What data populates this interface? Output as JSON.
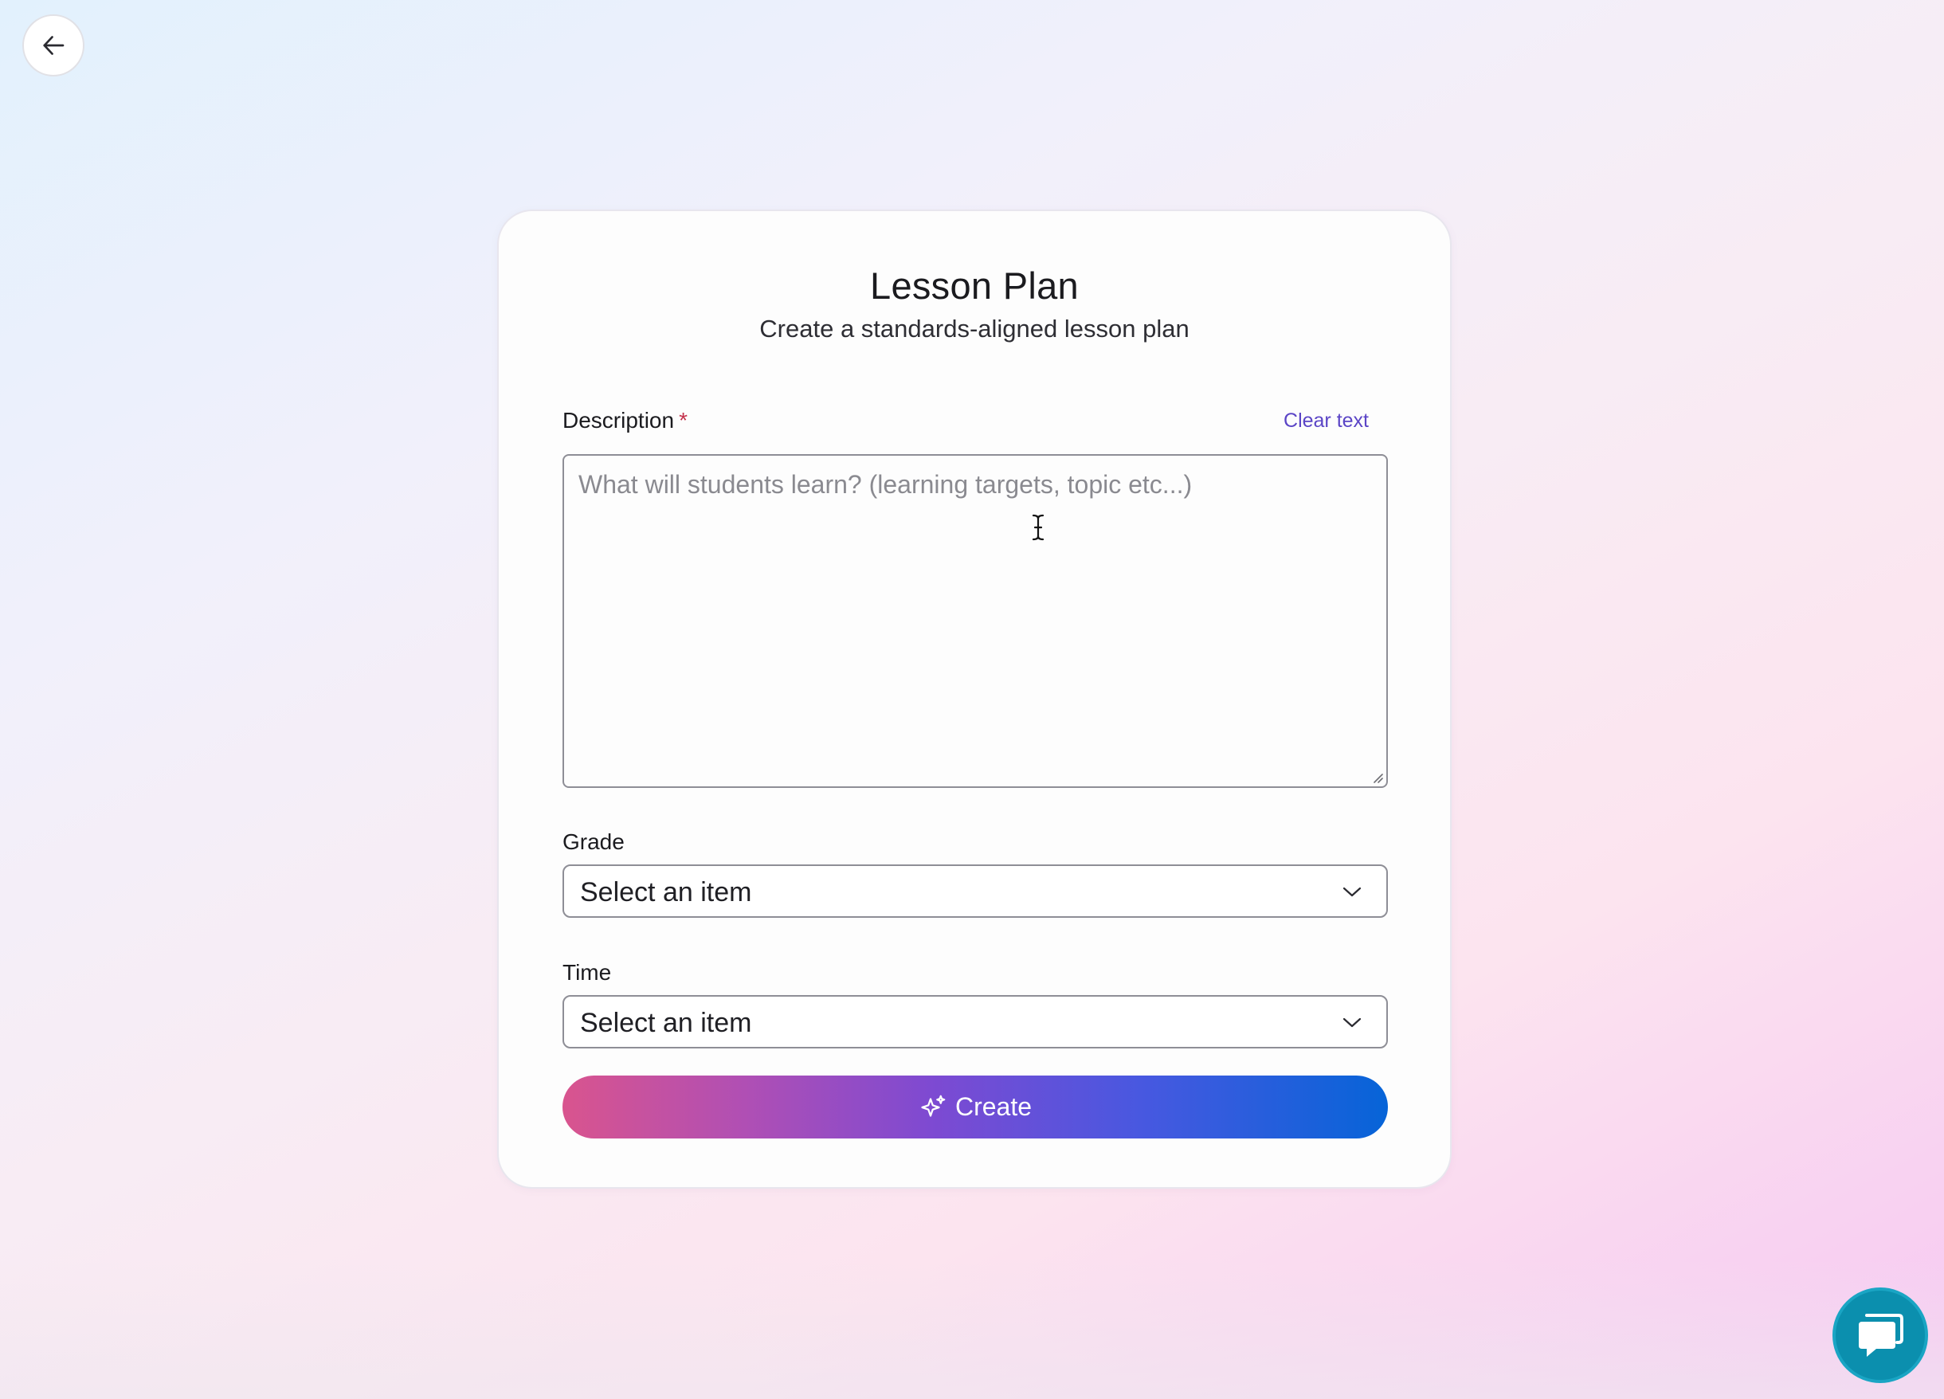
{
  "nav": {
    "back_icon": "arrow-left-icon"
  },
  "card": {
    "title": "Lesson Plan",
    "subtitle": "Create a standards-aligned lesson plan"
  },
  "description": {
    "label": "Description",
    "required_marker": "*",
    "clear_label": "Clear text",
    "placeholder": "What will students learn? (learning targets, topic etc...)",
    "value": ""
  },
  "grade": {
    "label": "Grade",
    "selected": "Select an item"
  },
  "time": {
    "label": "Time",
    "selected": "Select an item"
  },
  "create_button": {
    "label": "Create",
    "icon": "sparkle-icon"
  },
  "chat": {
    "icon": "chat-bubble-icon"
  },
  "colors": {
    "accent_link": "#5b45c6",
    "required": "#c4314b",
    "button_gradient_start": "#d9548e",
    "button_gradient_end": "#0664d8",
    "chat_button": "#0b8fae"
  }
}
